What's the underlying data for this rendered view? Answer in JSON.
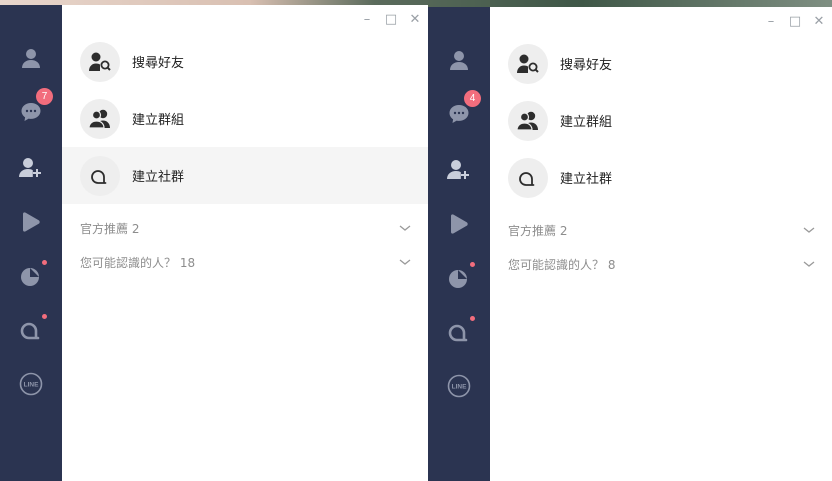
{
  "windows": [
    {
      "controls": {
        "minimize": "–",
        "maximize": "□",
        "close": "✕"
      },
      "sidebar": {
        "chat_badge": "7",
        "items": [
          "person-icon",
          "chat-icon",
          "add-friend-icon",
          "play-icon",
          "today-icon",
          "openchat-icon",
          "line-icon"
        ]
      },
      "actions": [
        {
          "label": "搜尋好友"
        },
        {
          "label": "建立群組"
        },
        {
          "label": "建立社群"
        }
      ],
      "sections": [
        {
          "label": "官方推薦 2"
        },
        {
          "label": "您可能認識的人？ 18"
        }
      ]
    },
    {
      "controls": {
        "minimize": "–",
        "maximize": "□",
        "close": "✕"
      },
      "sidebar": {
        "chat_badge": "4",
        "items": [
          "person-icon",
          "chat-icon",
          "add-friend-icon",
          "play-icon",
          "today-icon",
          "openchat-icon",
          "line-icon"
        ]
      },
      "actions": [
        {
          "label": "搜尋好友"
        },
        {
          "label": "建立群組"
        },
        {
          "label": "建立社群"
        }
      ],
      "sections": [
        {
          "label": "官方推薦 2"
        },
        {
          "label": "您可能認識的人？ 8"
        }
      ]
    }
  ],
  "colors": {
    "sidebar": "#2b3451",
    "icon": "#8e95aa",
    "badge": "#f26d7d",
    "selected_row": "#f5f5f5"
  }
}
